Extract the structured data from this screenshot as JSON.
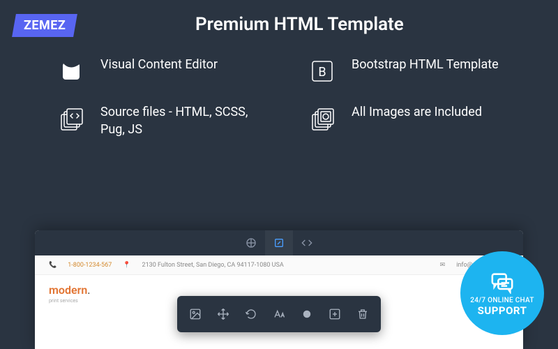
{
  "logo_text": "ZEMEZ",
  "headline": "Premium HTML Template",
  "features": [
    {
      "icon": "leaf",
      "text": "Visual Content Editor"
    },
    {
      "icon": "bootstrap",
      "text": "Bootstrap HTML Template"
    },
    {
      "icon": "files",
      "text": "Source files - HTML, SCSS, Pug, JS"
    },
    {
      "icon": "camera-files",
      "text": "All Images are Included"
    }
  ],
  "preview": {
    "phone": "1-800-1234-567",
    "address": "2130 Fulton Street, San Diego, CA 94117-1080 USA",
    "email": "info@demolink.org",
    "brand_main": "modern",
    "brand_dot": ".",
    "brand_sub": "print services"
  },
  "tabs": [
    "compass",
    "edit",
    "code"
  ],
  "tools": [
    "image",
    "move",
    "rotate",
    "text",
    "record",
    "add",
    "delete"
  ],
  "chat": {
    "line1": "24/7 ONLINE CHAT",
    "line2": "SUPPORT"
  }
}
